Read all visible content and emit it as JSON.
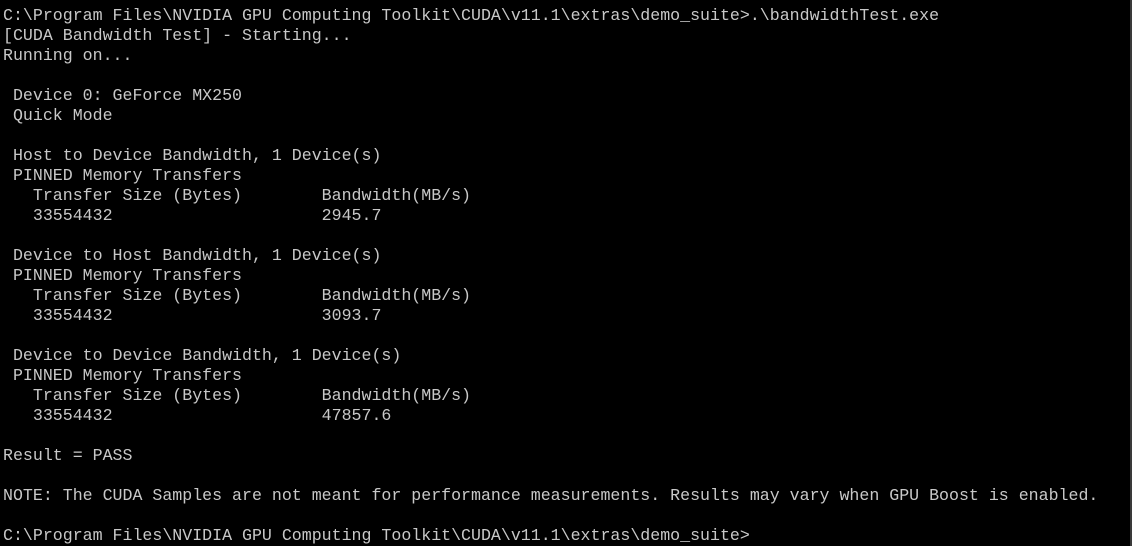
{
  "colors": {
    "background": "#000000",
    "text": "#c8c8c8"
  },
  "console": {
    "lines": [
      "C:\\Program Files\\NVIDIA GPU Computing Toolkit\\CUDA\\v11.1\\extras\\demo_suite>.\\bandwidthTest.exe",
      "[CUDA Bandwidth Test] - Starting...",
      "Running on...",
      "",
      " Device 0: GeForce MX250",
      " Quick Mode",
      "",
      " Host to Device Bandwidth, 1 Device(s)",
      " PINNED Memory Transfers",
      "   Transfer Size (Bytes)        Bandwidth(MB/s)",
      "   33554432                     2945.7",
      "",
      " Device to Host Bandwidth, 1 Device(s)",
      " PINNED Memory Transfers",
      "   Transfer Size (Bytes)        Bandwidth(MB/s)",
      "   33554432                     3093.7",
      "",
      " Device to Device Bandwidth, 1 Device(s)",
      " PINNED Memory Transfers",
      "   Transfer Size (Bytes)        Bandwidth(MB/s)",
      "   33554432                     47857.6",
      "",
      "Result = PASS",
      "",
      "NOTE: The CUDA Samples are not meant for performance measurements. Results may vary when GPU Boost is enabled.",
      "",
      "C:\\Program Files\\NVIDIA GPU Computing Toolkit\\CUDA\\v11.1\\extras\\demo_suite>"
    ]
  }
}
